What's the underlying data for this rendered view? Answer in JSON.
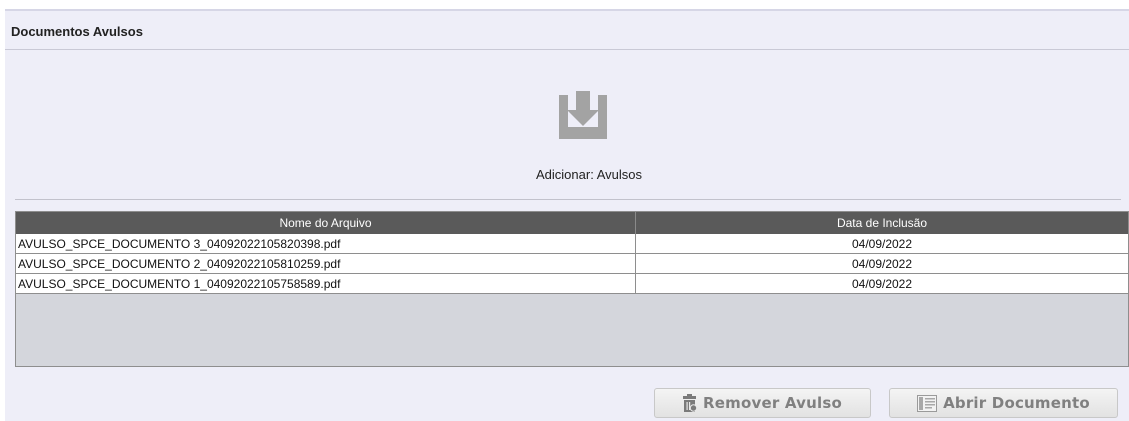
{
  "panel": {
    "title": "Documentos Avulsos"
  },
  "upload": {
    "label": "Adicionar: Avulsos",
    "icon": "download-tray-icon"
  },
  "grid": {
    "columns": [
      "Nome do Arquivo",
      "Data de Inclusão"
    ],
    "rows": [
      {
        "name": "AVULSO_SPCE_DOCUMENTO 3_04092022105820398.pdf",
        "date": "04/09/2022"
      },
      {
        "name": "AVULSO_SPCE_DOCUMENTO 2_04092022105810259.pdf",
        "date": "04/09/2022"
      },
      {
        "name": "AVULSO_SPCE_DOCUMENTO 1_04092022105758589.pdf",
        "date": "04/09/2022"
      }
    ]
  },
  "buttons": {
    "remove_label": "Remover Avulso",
    "remove_icon": "trash-icon",
    "open_label": "Abrir Documento",
    "open_icon": "document-icon"
  },
  "colors": {
    "panel_bg": "#eeeef8",
    "header_bg": "#5a5a5a",
    "grid_bg": "#d4d6dc",
    "button_text": "#808080"
  }
}
